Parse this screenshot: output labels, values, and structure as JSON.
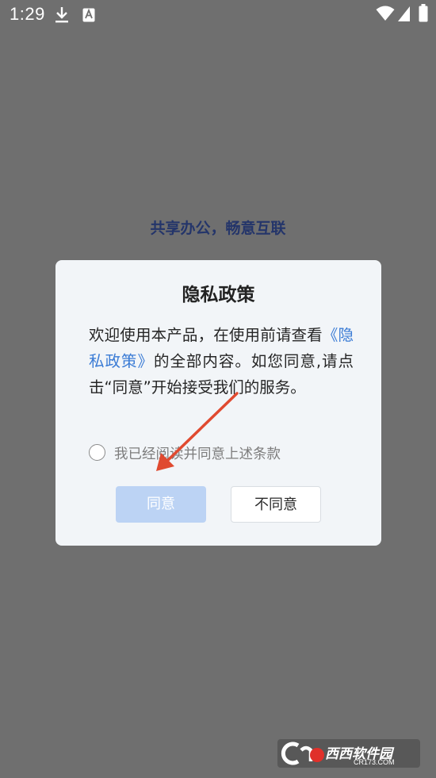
{
  "status_bar": {
    "time": "1:29",
    "icons": [
      "download-icon",
      "text-a-icon",
      "wifi-icon",
      "signal-icon",
      "battery-icon"
    ]
  },
  "background": {
    "slogan": "共享办公，畅意互联"
  },
  "dialog": {
    "title": "隐私政策",
    "body": {
      "intro": "欢迎使用本产品，在使用前请查看",
      "link": "《隐私政策》",
      "outro": "的全部内容。如您同意,请点击“同意”开始接受我们的服务。"
    },
    "agree_checkbox": {
      "label": "我已经阅读并同意上述条款",
      "checked": false
    },
    "buttons": {
      "agree": "同意",
      "disagree": "不同意"
    }
  },
  "colors": {
    "overlay": "#6f6f6f",
    "link": "#3a7bd5",
    "agree_button_disabled": "#bcd3f4",
    "slogan": "#24356a",
    "annotation_arrow": "#e04a30"
  },
  "watermark": {
    "brand": "西西软件园",
    "url": "CR173.COM"
  }
}
